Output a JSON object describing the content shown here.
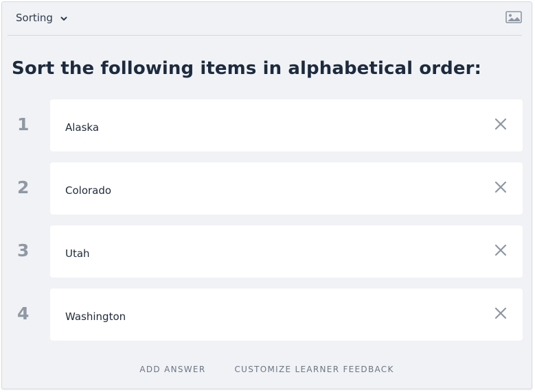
{
  "header": {
    "type_label": "Sorting",
    "type_icon": "chevron-down-icon",
    "image_icon": "image-icon"
  },
  "question": {
    "text": "Sort the following items in alphabetical order:"
  },
  "answers": [
    {
      "number": "1",
      "text": "Alaska"
    },
    {
      "number": "2",
      "text": "Colorado"
    },
    {
      "number": "3",
      "text": "Utah"
    },
    {
      "number": "4",
      "text": "Washington"
    }
  ],
  "footer": {
    "add_answer": "ADD ANSWER",
    "customize_feedback": "CUSTOMIZE LEARNER FEEDBACK"
  },
  "colors": {
    "panel_background": "#f1f2f5",
    "card_background": "#ffffff",
    "heading": "#1d2b3f",
    "number": "#8f98a4",
    "link": "#6b7685"
  }
}
